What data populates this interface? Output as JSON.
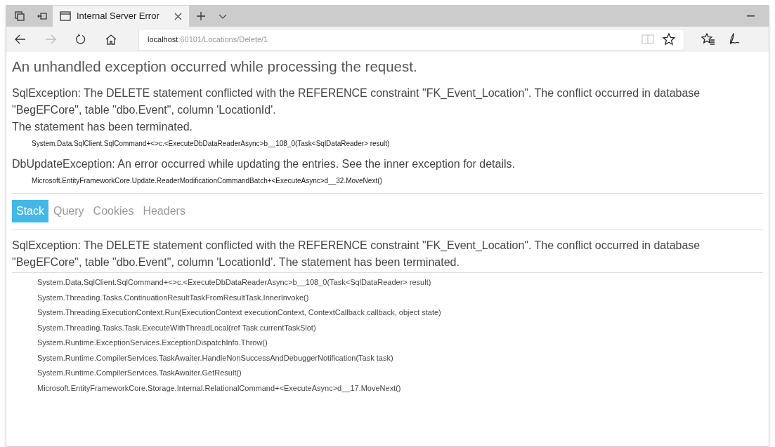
{
  "tab": {
    "title": "Internal Server Error",
    "selected": true
  },
  "address": {
    "host": "localhost",
    "path": ":60101/Locations/Delete/1"
  },
  "heading": "An unhandled exception occurred while processing the request.",
  "exceptions": [
    {
      "message": "SqlException: The DELETE statement conflicted with the REFERENCE constraint \"FK_Event_Location\". The conflict occurred in database \"BegEFCore\", table \"dbo.Event\", column 'LocationId'.",
      "extra": "The statement has been terminated.",
      "frame": "System.Data.SqlClient.SqlCommand+<>c.<ExecuteDbDataReaderAsync>b__108_0(Task<SqlDataReader> result)"
    },
    {
      "message": "DbUpdateException: An error occurred while updating the entries. See the inner exception for details.",
      "frame": "Microsoft.EntityFrameworkCore.Update.ReaderModificationCommandBatch+<ExecuteAsync>d__32.MoveNext()"
    }
  ],
  "tabs": [
    {
      "label": "Stack",
      "selected": true
    },
    {
      "label": "Query",
      "selected": false
    },
    {
      "label": "Cookies",
      "selected": false
    },
    {
      "label": "Headers",
      "selected": false
    }
  ],
  "stack": {
    "message": "SqlException: The DELETE statement conflicted with the REFERENCE constraint \"FK_Event_Location\". The conflict occurred in database \"BegEFCore\", table \"dbo.Event\", column 'LocationId'. The statement has been terminated.",
    "frames": [
      "System.Data.SqlClient.SqlCommand+<>c.<ExecuteDbDataReaderAsync>b__108_0(Task<SqlDataReader> result)",
      "System.Threading.Tasks.ContinuationResultTaskFromResultTask.InnerInvoke()",
      "System.Threading.ExecutionContext.Run(ExecutionContext executionContext, ContextCallback callback, object state)",
      "System.Threading.Tasks.Task.ExecuteWithThreadLocal(ref Task currentTaskSlot)",
      "System.Runtime.ExceptionServices.ExceptionDispatchInfo.Throw()",
      "System.Runtime.CompilerServices.TaskAwaiter.HandleNonSuccessAndDebuggerNotification(Task task)",
      "System.Runtime.CompilerServices.TaskAwaiter.GetResult()",
      "Microsoft.EntityFrameworkCore.Storage.Internal.RelationalCommand+<ExecuteAsync>d__17.MoveNext()"
    ]
  }
}
